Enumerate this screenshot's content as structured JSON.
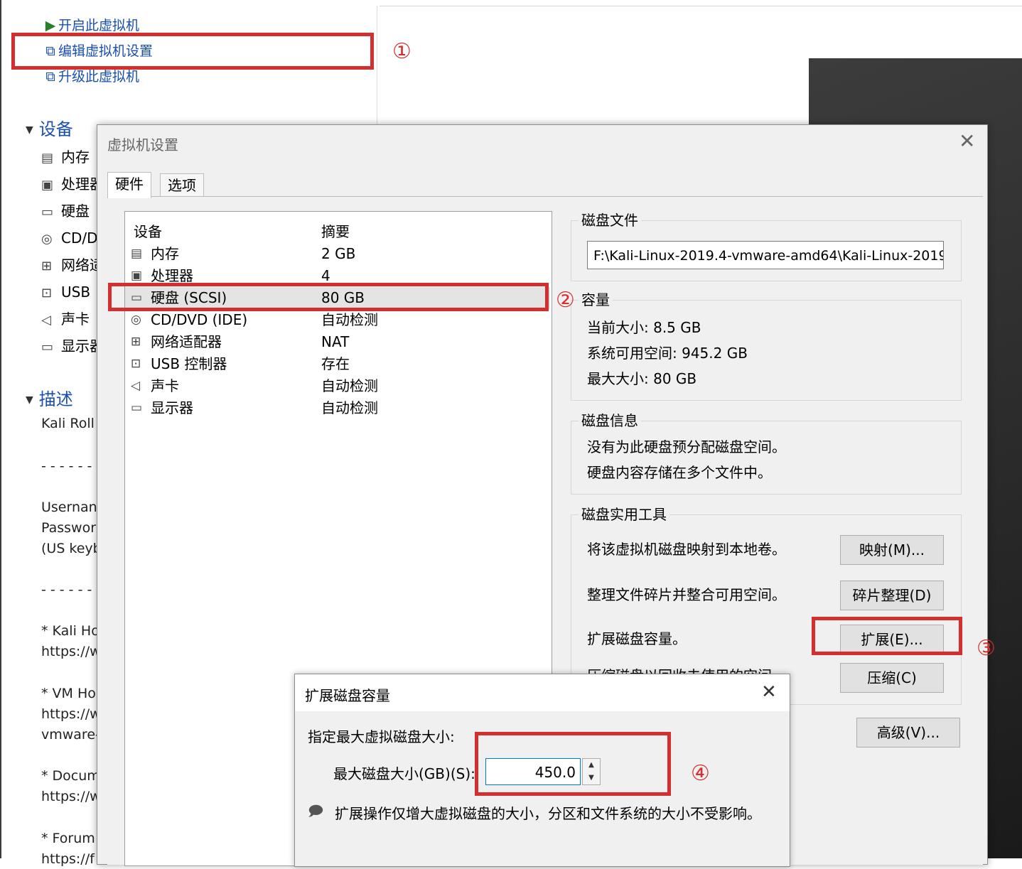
{
  "left_panel": {
    "actions": [
      {
        "label": "开启此虚拟机",
        "icon": "play-icon"
      },
      {
        "label": "编辑虚拟机设置",
        "icon": "edit-settings-icon"
      },
      {
        "label": "升级此虚拟机",
        "icon": "upgrade-icon"
      }
    ],
    "devices_header": "设备",
    "devices": [
      {
        "label": "内存",
        "icon": "memory-icon"
      },
      {
        "label": "处理器",
        "icon": "processor-icon"
      },
      {
        "label": "硬盘",
        "icon": "hard-disk-icon"
      },
      {
        "label": "CD/D",
        "icon": "cd-icon"
      },
      {
        "label": "网络适",
        "icon": "network-icon"
      },
      {
        "label": "USB",
        "icon": "usb-icon"
      },
      {
        "label": "声卡",
        "icon": "sound-icon"
      },
      {
        "label": "显示器",
        "icon": "display-icon"
      }
    ],
    "description_header": "描述",
    "description_lines": [
      "Kali Roll",
      "- - - - - -",
      "Usernan",
      "Passwor",
      "(US keyb",
      "- - - - - -",
      "* Kali Ho",
      "https://w",
      "* VM Ho",
      "https://w",
      "vmware-",
      "* Docum",
      "https://w",
      "* Forum",
      "https://f"
    ]
  },
  "settings": {
    "title": "虚拟机设置",
    "close": "✕",
    "tabs": [
      "硬件",
      "选项"
    ],
    "columns": {
      "device": "设备",
      "summary": "摘要"
    },
    "rows": [
      {
        "device": "内存",
        "summary": "2 GB",
        "icon": "memory-icon"
      },
      {
        "device": "处理器",
        "summary": "4",
        "icon": "processor-icon"
      },
      {
        "device": "硬盘 (SCSI)",
        "summary": "80 GB",
        "icon": "hard-disk-icon"
      },
      {
        "device": "CD/DVD (IDE)",
        "summary": "自动检测",
        "icon": "cd-icon"
      },
      {
        "device": "网络适配器",
        "summary": "NAT",
        "icon": "network-icon"
      },
      {
        "device": "USB 控制器",
        "summary": "存在",
        "icon": "usb-icon"
      },
      {
        "device": "声卡",
        "summary": "自动检测",
        "icon": "sound-icon"
      },
      {
        "device": "显示器",
        "summary": "自动检测",
        "icon": "display-icon"
      }
    ],
    "disk_file": {
      "title": "磁盘文件",
      "path": "F:\\Kali-Linux-2019.4-vmware-amd64\\Kali-Linux-2019."
    },
    "capacity": {
      "title": "容量",
      "current": "当前大小: 8.5 GB",
      "available": "系统可用空间: 945.2 GB",
      "max": "最大大小: 80 GB"
    },
    "disk_info": {
      "title": "磁盘信息",
      "line1": "没有为此硬盘预分配磁盘空间。",
      "line2": "硬盘内容存储在多个文件中。"
    },
    "utilities": {
      "title": "磁盘实用工具",
      "map_text": "将该虚拟机磁盘映射到本地卷。",
      "map_button": "映射(M)...",
      "defrag_text": "整理文件碎片并整合可用空间。",
      "defrag_button": "碎片整理(D)",
      "expand_text": "扩展磁盘容量。",
      "expand_button": "扩展(E)...",
      "compact_text": "压缩磁盘以回收未使用的空间",
      "compact_button": "压缩(C)"
    },
    "advanced_button": "高级(V)..."
  },
  "expand_dialog": {
    "title": "扩展磁盘容量",
    "close": "✕",
    "instruction": "指定最大虚拟磁盘大小:",
    "field_label": "最大磁盘大小(GB)(S):",
    "field_value": "450.0",
    "note": "扩展操作仅增大虚拟磁盘的大小，分区和文件系统的大小不受影响。"
  },
  "annotations": [
    "①",
    "②",
    "③",
    "④"
  ],
  "colors": {
    "annotation": "#d32f2f",
    "link": "#1a4fb0"
  }
}
